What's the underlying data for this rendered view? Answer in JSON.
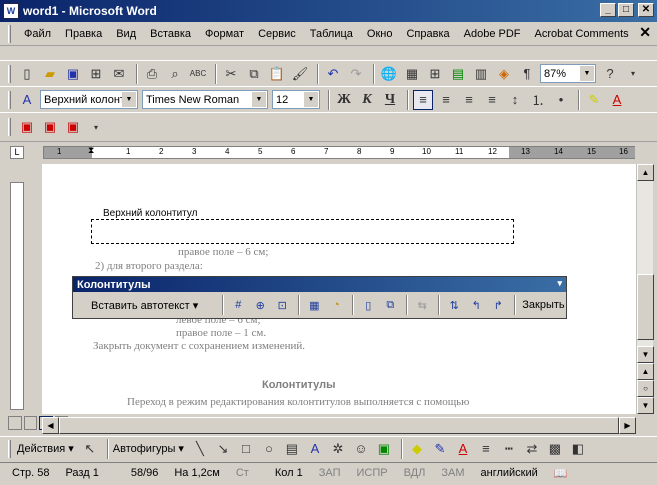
{
  "window": {
    "title": "word1 - Microsoft Word",
    "minimize": "_",
    "maximize": "□",
    "close": "✕",
    "doc_close": "✕"
  },
  "menu": [
    "Файл",
    "Правка",
    "Вид",
    "Вставка",
    "Формат",
    "Сервис",
    "Таблица",
    "Окно",
    "Справка",
    "Adobe PDF",
    "Acrobat Comments"
  ],
  "standard": {
    "zoom": "87%",
    "para_mark": "¶"
  },
  "formatting": {
    "style": "Верхний колонт",
    "font": "Times New Roman",
    "size": "12",
    "bold": "Ж",
    "italic": "К",
    "underline": "Ч"
  },
  "ruler": {
    "numbers": [
      "1",
      "1",
      "2",
      "3",
      "4",
      "5",
      "6",
      "7",
      "8",
      "9",
      "10",
      "11",
      "12",
      "13",
      "14",
      "15",
      "16"
    ]
  },
  "document": {
    "header_label": "Верхний колонтитул",
    "lines": [
      "правое поле – 6 см;",
      "2)    для второго раздела:",
      "левое поле – 6 см;",
      "правое поле – 1 см.",
      "Закрыть документ с сохранением изменений.",
      "Колонтитулы",
      "Переход в режим редактирования колонтитулов выполняется с помощью"
    ]
  },
  "hf_toolbar": {
    "title": "Колонтитулы",
    "insert_autotext": "Вставить автотекст ▾",
    "close": "Закрыть"
  },
  "drawing": {
    "actions": "Действия ▾",
    "autoshapes": "Автофигуры ▾"
  },
  "status": {
    "page": "Стр. 58",
    "section": "Разд 1",
    "pages": "58/96",
    "at": "На 1,2см",
    "line": "Ст",
    "col": "Кол 1",
    "rec": "ЗАП",
    "trk": "ИСПР",
    "ext": "ВДЛ",
    "ovr": "ЗАМ",
    "lang": "английский"
  }
}
